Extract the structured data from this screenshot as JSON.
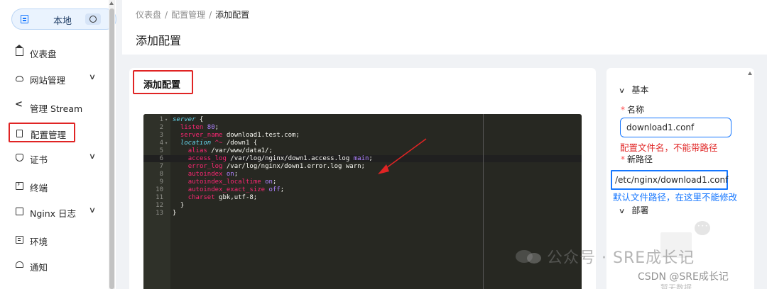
{
  "sidebar": {
    "env": {
      "label": "本地"
    },
    "items": [
      {
        "name": "dashboard",
        "label": "仪表盘",
        "icon": "home-icon",
        "chevron": false
      },
      {
        "name": "site-management",
        "label": "网站管理",
        "icon": "cloud-icon",
        "chevron": true
      },
      {
        "name": "stream-management",
        "label": "管理 Stream",
        "icon": "share-icon",
        "chevron": false
      },
      {
        "name": "config-management",
        "label": "配置管理",
        "icon": "file-icon",
        "chevron": false,
        "active": true
      },
      {
        "name": "certificates",
        "label": "证书",
        "icon": "shield-icon",
        "chevron": true
      },
      {
        "name": "terminal",
        "label": "终端",
        "icon": "terminal-icon",
        "chevron": false
      },
      {
        "name": "nginx-log",
        "label": "Nginx 日志",
        "icon": "document-icon",
        "chevron": true
      },
      {
        "name": "environment",
        "label": "环境",
        "icon": "list-icon",
        "chevron": false
      },
      {
        "name": "notifications",
        "label": "通知",
        "icon": "bell-icon",
        "chevron": false
      }
    ]
  },
  "header": {
    "breadcrumb": [
      "仪表盘",
      "配置管理",
      "添加配置"
    ],
    "title": "添加配置"
  },
  "card": {
    "title": "添加配置"
  },
  "editor": {
    "lines": [
      {
        "n": "1",
        "fold": true,
        "html": "<span class='kw'>server</span> {"
      },
      {
        "n": "2",
        "fold": false,
        "html": "  <span class='prop'>listen</span> <span class='num'>80</span>;"
      },
      {
        "n": "3",
        "fold": false,
        "html": "  <span class='prop'>server_name</span> download1.test.com;"
      },
      {
        "n": "4",
        "fold": true,
        "html": "  <span class='kw'>location</span> <span class='prop'>^~</span> /down1 {"
      },
      {
        "n": "5",
        "fold": false,
        "html": "    <span class='prop'>alias</span> /var/www/data1/;"
      },
      {
        "n": "6",
        "fold": false,
        "html": "    <span class='prop'>access_log</span> /var/log/nginx/down1.access.log <span class='num'>main</span>;"
      },
      {
        "n": "7",
        "fold": false,
        "html": "    <span class='prop'>error_log</span> /var/log/nginx/down1.error.log warn;"
      },
      {
        "n": "8",
        "fold": false,
        "html": "    <span class='prop'>autoindex</span> <span class='num'>on</span>;"
      },
      {
        "n": "9",
        "fold": false,
        "html": "    <span class='prop'>autoindex_localtime</span> <span class='num'>on</span>;"
      },
      {
        "n": "10",
        "fold": false,
        "html": "    <span class='prop'>autoindex_exact_size</span> <span class='num'>off</span>;"
      },
      {
        "n": "11",
        "fold": false,
        "html": "    <span class='prop'>charset</span> gbk,utf-8;"
      },
      {
        "n": "12",
        "fold": false,
        "html": "  }"
      },
      {
        "n": "13",
        "fold": false,
        "html": "}"
      }
    ]
  },
  "panel": {
    "basic_section": "基本",
    "name_label": "名称",
    "name_value": "download1.conf",
    "name_note": "配置文件名，不能带路径",
    "path_label": "新路径",
    "path_value": "/etc/nginx/download1.conf",
    "path_note": "默认文件路径，在这里不能修改",
    "deploy_section": "部署",
    "empty_text": "暂无数据"
  },
  "watermark": {
    "text": "公众号 · SRE成长记",
    "csdn": "CSDN @SRE成长记"
  },
  "colors": {
    "accent": "#1677ff",
    "annotation_red": "#e02424",
    "editor_bg": "#272822"
  }
}
